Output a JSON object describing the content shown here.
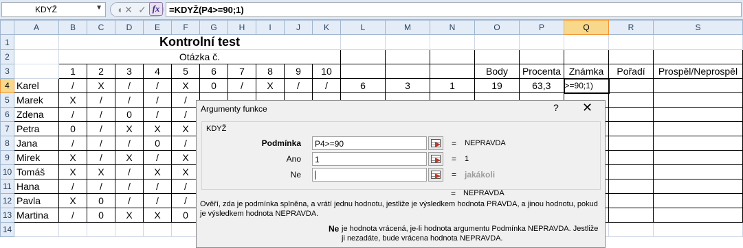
{
  "formula_bar": {
    "name_box": "KDYŽ",
    "formula": "=KDYŽ(P4>=90;1)",
    "fx_label": "fx"
  },
  "columns": [
    "A",
    "B",
    "C",
    "D",
    "E",
    "F",
    "G",
    "H",
    "I",
    "J",
    "K",
    "L",
    "M",
    "N",
    "O",
    "P",
    "Q",
    "R",
    "S"
  ],
  "selected_column": "Q",
  "selected_row": "4",
  "rows": [
    "1",
    "2",
    "3",
    "4",
    "5",
    "6",
    "7",
    "8",
    "9",
    "10",
    "11",
    "12",
    "13",
    "14"
  ],
  "sheet": {
    "title": "Kontrolní test",
    "question_header": "Otázka č.",
    "question_numbers": [
      "1",
      "2",
      "3",
      "4",
      "5",
      "6",
      "7",
      "8",
      "9",
      "10"
    ],
    "headers": {
      "body": "Body",
      "procenta": "Procenta",
      "znamka": "Známka",
      "poradi": "Pořadí",
      "prospel": "Prospěl/Neprospěl"
    },
    "karel": {
      "name": "Karel",
      "answers": [
        "/",
        "X",
        "/",
        "/",
        "X",
        "0",
        "/",
        "X",
        "/",
        "/"
      ],
      "L": "6",
      "M": "3",
      "N": "1",
      "body": "19",
      "procenta": "63,3",
      "editing": ">=90;1)"
    },
    "students": [
      {
        "name": "Marek",
        "answers": [
          "X",
          "/",
          "/",
          "/",
          "/"
        ]
      },
      {
        "name": "Zdena",
        "answers": [
          "/",
          "/",
          "0",
          "/",
          "/"
        ]
      },
      {
        "name": "Petra",
        "answers": [
          "0",
          "/",
          "X",
          "X",
          "X"
        ]
      },
      {
        "name": "Jana",
        "answers": [
          "/",
          "/",
          "/",
          "0",
          "/"
        ]
      },
      {
        "name": "Mirek",
        "answers": [
          "X",
          "/",
          "X",
          "/",
          "X"
        ]
      },
      {
        "name": "Tomáš",
        "answers": [
          "X",
          "X",
          "/",
          "X",
          "X"
        ]
      },
      {
        "name": "Hana",
        "answers": [
          "/",
          "/",
          "/",
          "/",
          "/"
        ]
      },
      {
        "name": "Pavla",
        "answers": [
          "X",
          "0",
          "/",
          "/",
          "/"
        ]
      },
      {
        "name": "Martina",
        "answers": [
          "/",
          "0",
          "X",
          "X",
          "0"
        ]
      }
    ]
  },
  "dialog": {
    "title": "Argumenty funkce",
    "help": "?",
    "close": "✕",
    "function_name": "KDYŽ",
    "args": [
      {
        "label": "Podmínka",
        "value": "P4>=90",
        "result": "NEPRAVDA",
        "bold": true
      },
      {
        "label": "Ano",
        "value": "1",
        "result": "1",
        "bold": false
      },
      {
        "label": "Ne",
        "value": "",
        "result": "jakákoli",
        "bold": false
      }
    ],
    "equals": "=",
    "formula_result": "NEPRAVDA",
    "description": "Ověří, zda je podmínka splněna, a vrátí jednu hodnotu, jestliže je výsledkem hodnota PRAVDA, a jinou hodnotu, pokud je výsledkem hodnota NEPRAVDA.",
    "arg_name": "Ne",
    "arg_description": "je hodnota vrácená, je-li hodnota argumentu Podmínka NEPRAVDA. Jestliže ji nezadáte, bude vrácena hodnota NEPRAVDA."
  }
}
